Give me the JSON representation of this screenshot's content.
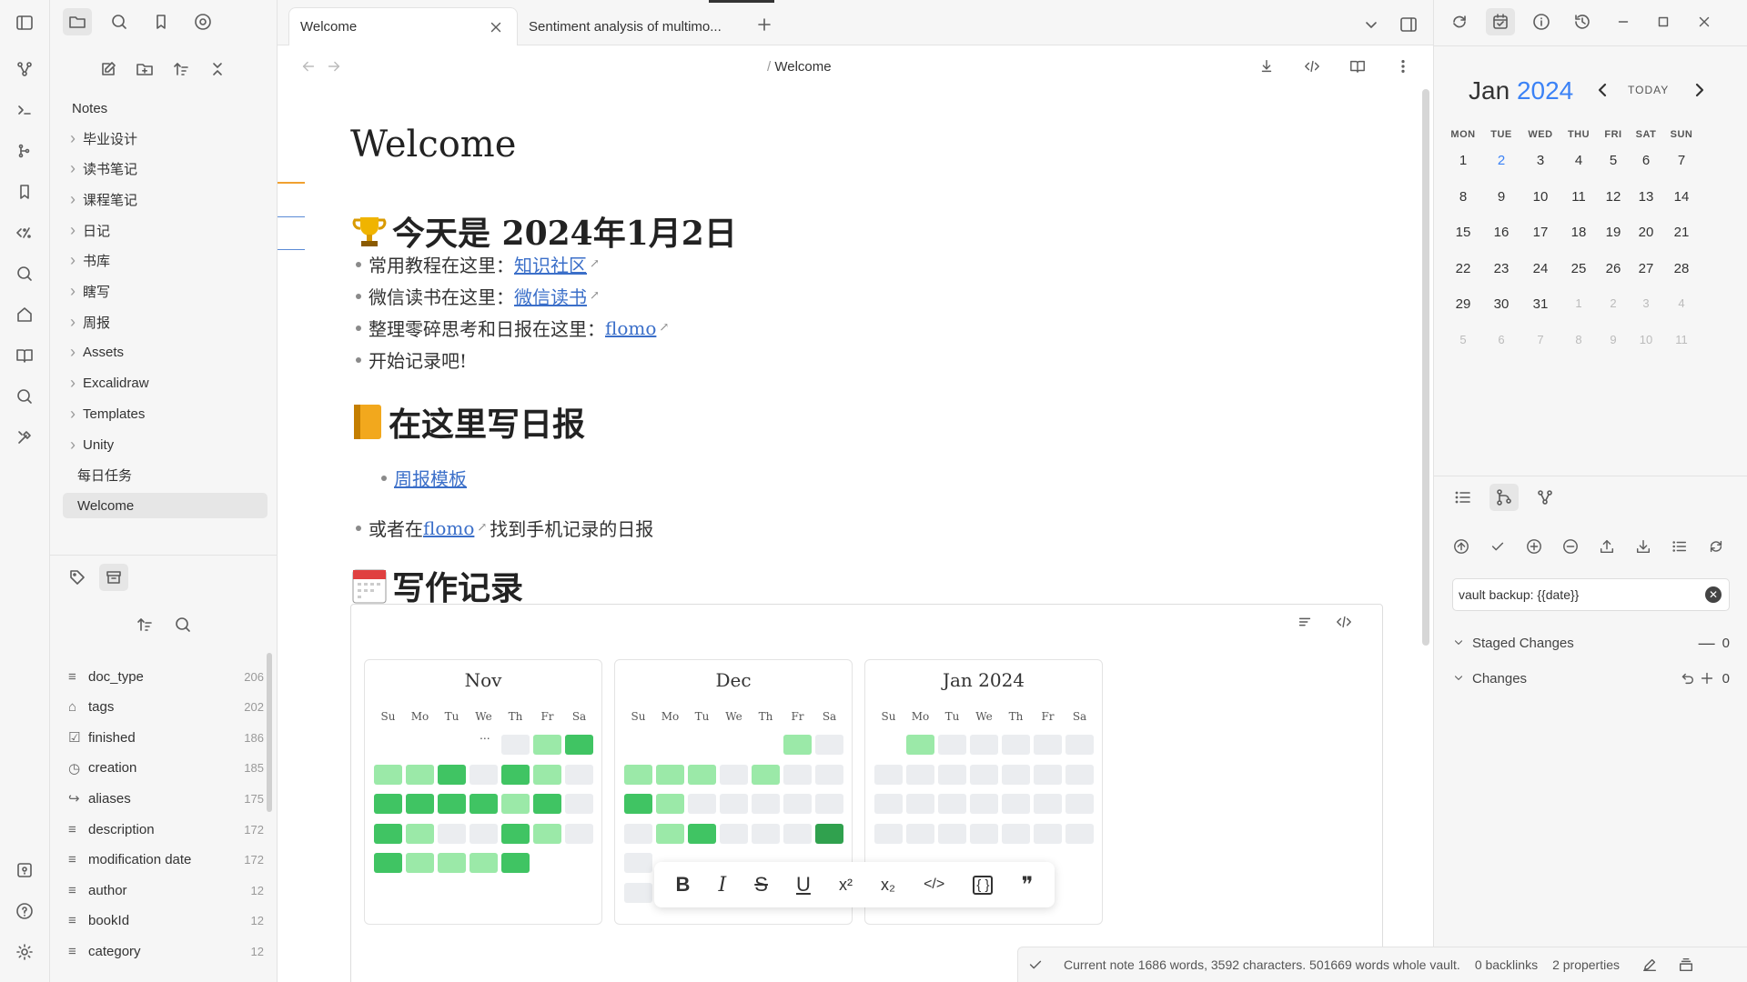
{
  "ribbon": {
    "icons": [
      "sidebar-toggle-icon",
      "graph-icon",
      "terminal-icon",
      "outline-icon",
      "bookmark-icon",
      "percent-icon",
      "search-icon",
      "home-icon",
      "book-icon",
      "search-alt-icon",
      "tools-icon",
      "help-box-icon",
      "help-icon",
      "settings-icon"
    ]
  },
  "sidebar": {
    "root_label": "Notes",
    "folders": [
      "毕业设计",
      "读书笔记",
      "课程笔记",
      "日记",
      "书库",
      "瞎写",
      "周报",
      "Assets",
      "Excalidraw",
      "Templates",
      "Unity"
    ],
    "files": [
      "每日任务",
      "Welcome"
    ],
    "properties": [
      {
        "name": "doc_type",
        "count": "206",
        "icon": "list-icon"
      },
      {
        "name": "tags",
        "count": "202",
        "icon": "tag-icon"
      },
      {
        "name": "finished",
        "count": "186",
        "icon": "checkbox-icon"
      },
      {
        "name": "creation",
        "count": "185",
        "icon": "clock-icon"
      },
      {
        "name": "aliases",
        "count": "175",
        "icon": "arrow-icon"
      },
      {
        "name": "description",
        "count": "172",
        "icon": "list-icon"
      },
      {
        "name": "modification date",
        "count": "172",
        "icon": "list-icon"
      },
      {
        "name": "author",
        "count": "12",
        "icon": "list-icon"
      },
      {
        "name": "bookId",
        "count": "12",
        "icon": "list-icon"
      },
      {
        "name": "category",
        "count": "12",
        "icon": "list-icon"
      }
    ]
  },
  "tabs": [
    {
      "label": "Welcome"
    },
    {
      "label": "Sentiment analysis of multimo..."
    }
  ],
  "header": {
    "breadcrumb_sep": "/",
    "breadcrumb": "Welcome"
  },
  "note": {
    "title": "Welcome",
    "h_today": "今天是 2024年1月2日",
    "items1": [
      {
        "text": "常用教程在这里：",
        "link": "知识社区"
      },
      {
        "text": "微信读书在这里：",
        "link": "微信读书"
      },
      {
        "text": "整理零碎思考和日报在这里：",
        "link": "flomo"
      },
      {
        "text": "开始记录吧!",
        "link": ""
      }
    ],
    "h_daily": "在这里写日报",
    "daily_link": "周报模板",
    "daily_pre": "或者在 ",
    "daily_flomo": "flomo",
    "daily_post": " 找到手机记录的日报",
    "h_writing": "写作记录"
  },
  "heatmap": {
    "dows": [
      "Su",
      "Mo",
      "Tu",
      "We",
      "Th",
      "Fr",
      "Sa"
    ],
    "months": [
      {
        "label": "Nov",
        "ellipsis": "...",
        "cells": [
          [
            -1,
            -1,
            -1,
            -1,
            0,
            1,
            3
          ],
          [
            1,
            1,
            3,
            0,
            3,
            1,
            0
          ],
          [
            3,
            3,
            3,
            3,
            1,
            3,
            0
          ],
          [
            3,
            1,
            0,
            0,
            3,
            1,
            0
          ],
          [
            3,
            1,
            1,
            1,
            3,
            -1,
            -1
          ]
        ]
      },
      {
        "label": "Dec",
        "cells": [
          [
            -1,
            -1,
            -1,
            -1,
            -1,
            1,
            0
          ],
          [
            1,
            1,
            1,
            0,
            1,
            0,
            0
          ],
          [
            3,
            1,
            0,
            0,
            0,
            0,
            0
          ],
          [
            0,
            1,
            3,
            0,
            0,
            0,
            4
          ],
          [
            0,
            -1,
            -1,
            -1,
            -1,
            -1,
            -1
          ],
          [
            0,
            -1,
            -1,
            -1,
            -1,
            -1,
            -1
          ]
        ]
      },
      {
        "label": "Jan 2024",
        "cells": [
          [
            -1,
            1,
            0,
            0,
            0,
            0,
            0
          ],
          [
            0,
            0,
            0,
            0,
            0,
            0,
            0
          ],
          [
            0,
            0,
            0,
            0,
            0,
            0,
            0
          ],
          [
            0,
            0,
            0,
            0,
            0,
            0,
            0
          ]
        ]
      }
    ],
    "colors": {
      "empty": "#ebedf0",
      "l1": "#9be9a8",
      "l3": "#40c463",
      "l4": "#30a14e"
    }
  },
  "format_bar": {
    "bold": "B",
    "italic": "I",
    "strike": "S",
    "underline": "U",
    "superscript": "x²",
    "subscript": "x₂",
    "code": "</>",
    "codeblock": "{ }",
    "quote": "❞"
  },
  "calendar": {
    "month": "Jan",
    "year": "2024",
    "today_label": "TODAY",
    "weekdays": [
      "MON",
      "TUE",
      "WED",
      "THU",
      "FRI",
      "SAT",
      "SUN"
    ],
    "weeks": [
      [
        "1",
        "2",
        "3",
        "4",
        "5",
        "6",
        "7"
      ],
      [
        "8",
        "9",
        "10",
        "11",
        "12",
        "13",
        "14"
      ],
      [
        "15",
        "16",
        "17",
        "18",
        "19",
        "20",
        "21"
      ],
      [
        "22",
        "23",
        "24",
        "25",
        "26",
        "27",
        "28"
      ],
      [
        "29",
        "30",
        "31",
        "1",
        "2",
        "3",
        "4"
      ],
      [
        "5",
        "6",
        "7",
        "8",
        "9",
        "10",
        "11"
      ]
    ],
    "accent": "#3b82f6"
  },
  "git": {
    "commit_message": "vault backup: {{date}}",
    "staged_label": "Staged Changes",
    "staged_count": "0",
    "changes_label": "Changes",
    "changes_count": "0"
  },
  "status": {
    "words": "Current note 1686 words, 3592 characters. 501669 words whole vault.",
    "backlinks": "0 backlinks",
    "properties": "2 properties"
  }
}
